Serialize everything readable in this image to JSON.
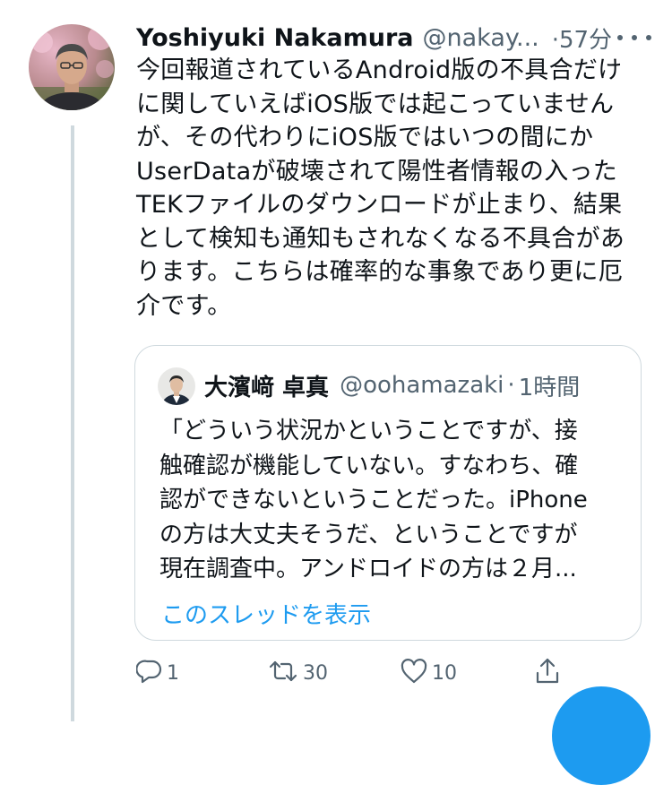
{
  "author": {
    "display_name": "Yoshiyuki Nakamura",
    "handle": "@nakay...",
    "time": "·57分"
  },
  "tweet": {
    "text_lines": [
      "今回報道されているAndroid版の不具合だけ",
      "に関していえばiOS版では起こっていません",
      "が、その代わりにiOS版ではいつの間にか",
      "UserDataが破壊されて陽性者情報の入った",
      "TEKファイルのダウンロードが止まり、結果",
      "として検知も通知もされなくなる不具合があ",
      "ります。こちらは確率的な事象であり更に厄",
      "介です。"
    ]
  },
  "quote": {
    "display_name": "大濱﨑 卓真",
    "handle": "@oohamazaki",
    "separator": "·",
    "time": "1時間",
    "text_lines": [
      "「どういう状況かということですが、接",
      "触確認が機能していない。すなわち、確",
      "認ができないということだった。iPhone",
      "の方は大丈夫そうだ、ということですが",
      "現在調査中。アンドロイドの方は２月..."
    ],
    "show_thread": "このスレッドを表示"
  },
  "actions": {
    "reply_count": "1",
    "retweet_count": "30",
    "like_count": "10"
  },
  "icons": {
    "more": "more-icon",
    "reply": "reply-icon",
    "retweet": "retweet-icon",
    "like": "heart-icon",
    "share": "share-icon",
    "compose": "compose-fab"
  },
  "colors": {
    "accent": "#1d9bf0",
    "secondary_text": "#536471",
    "border": "#cfd9de"
  }
}
